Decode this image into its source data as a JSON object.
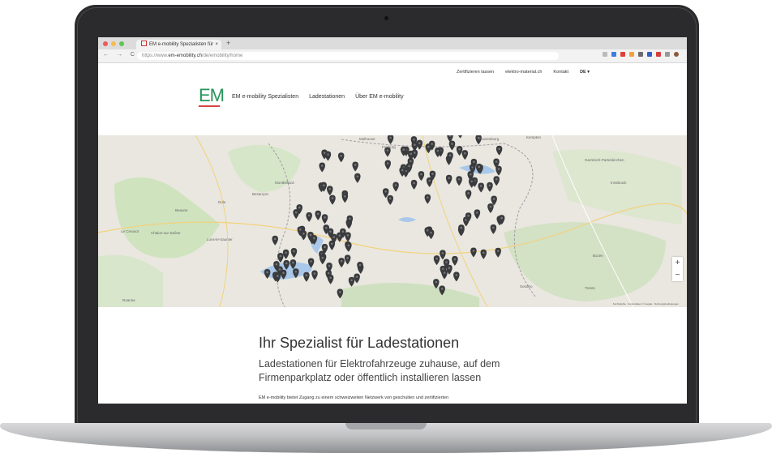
{
  "browser": {
    "tab_title": "EM e-mobility Spezialisten für",
    "tab_close": "×",
    "new_tab": "+",
    "nav_glyphs": "← → C",
    "url_prefix": "https://www.",
    "url_host": "em-emobility.ch",
    "url_path": "/de/emobility/home"
  },
  "utility_nav": {
    "items": [
      "Zertifizieren lassen",
      "elektro-material.ch",
      "Kontakt"
    ],
    "language": "DE ▾"
  },
  "logo": {
    "text": "EM"
  },
  "main_nav": {
    "items": [
      "EM e-mobility Spezialisten",
      "Ladestationen",
      "Über EM e-mobility"
    ]
  },
  "map": {
    "labels": [
      "Mulhouse",
      "Freiburg",
      "Montbéliard",
      "Besançon",
      "Dole",
      "Beaune",
      "Le Creusot",
      "Chalon-sur-Saône",
      "Lons-le-Saunier",
      "Ravensburg",
      "Kempten",
      "Garmisch-Partenkirchen",
      "Innsbruck",
      "Bozen",
      "Trento",
      "Sondrio",
      "Roanne"
    ],
    "zoom_in": "+",
    "zoom_out": "−",
    "attribution": "Kurzbefehle · Kartendaten © Google · Nutzungsbedingungen"
  },
  "hero": {
    "title": "Ihr Spezialist für Ladestationen",
    "subtitle": "Ladestationen für Elektrofahrzeuge zuhause, auf dem Firmenparkplatz oder öffentlich installieren lassen",
    "body": "EM e-mobility bietet Zugang zu einem schweizweiten Netzwerk von geschulten und zertifizierten"
  },
  "colors": {
    "brand_green": "#27945a",
    "brand_red": "#d64545",
    "pin": "#3a3b3e"
  }
}
